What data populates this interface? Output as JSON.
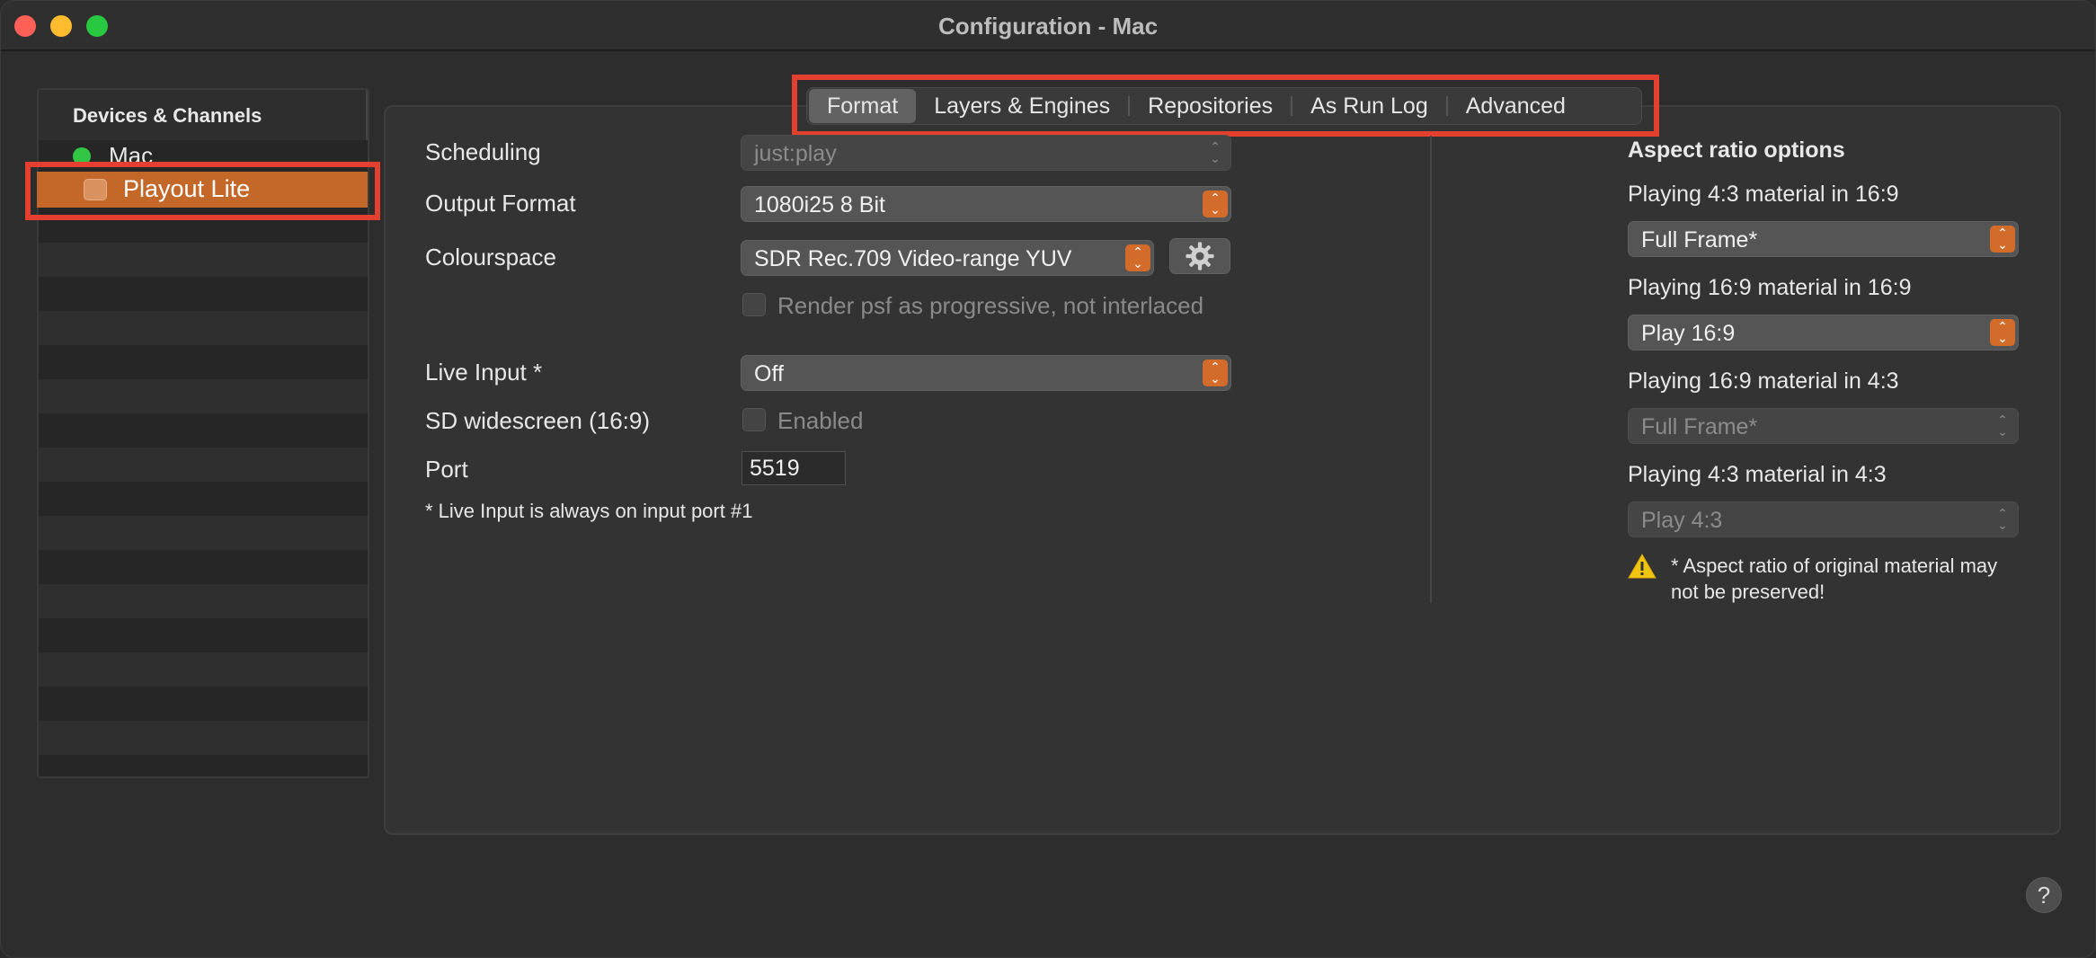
{
  "window": {
    "title": "Configuration - Mac"
  },
  "sidebar": {
    "header": "Devices & Channels",
    "device": {
      "label": "Mac",
      "status_color": "#31c744"
    },
    "selected_item": {
      "label": "Playout Lite",
      "highlight_color": "#c4682a"
    }
  },
  "tabs": [
    {
      "label": "Format",
      "active": true
    },
    {
      "label": "Layers & Engines",
      "active": false
    },
    {
      "label": "Repositories",
      "active": false
    },
    {
      "label": "As Run Log",
      "active": false
    },
    {
      "label": "Advanced",
      "active": false
    }
  ],
  "format": {
    "scheduling": {
      "label": "Scheduling",
      "value": "just:play",
      "enabled": false
    },
    "output_format": {
      "label": "Output Format",
      "value": "1080i25 8 Bit"
    },
    "colourspace": {
      "label": "Colourspace",
      "value": "SDR Rec.709 Video-range YUV"
    },
    "render_psf": {
      "label": "Render psf as progressive, not interlaced",
      "checked": false,
      "enabled": false
    },
    "live_input": {
      "label": "Live Input *",
      "value": "Off"
    },
    "sd_widescreen": {
      "label": "SD widescreen (16:9)",
      "checkbox_label": "Enabled",
      "checked": false,
      "enabled": false
    },
    "port": {
      "label": "Port",
      "value": "5519"
    },
    "note": "* Live Input is always on input port #1"
  },
  "aspect": {
    "title": "Aspect ratio options",
    "options": [
      {
        "label": "Playing 4:3 material in 16:9",
        "value": "Full Frame*",
        "enabled": true
      },
      {
        "label": "Playing 16:9 material in 16:9",
        "value": "Play 16:9",
        "enabled": true
      },
      {
        "label": "Playing 16:9 material in 4:3",
        "value": "Full Frame*",
        "enabled": false
      },
      {
        "label": "Playing 4:3 material in 4:3",
        "value": "Play 4:3",
        "enabled": false
      }
    ],
    "warning": "* Aspect ratio of original material may not be preserved!"
  },
  "help": {
    "label": "?"
  },
  "colors": {
    "accent": "#d36c2a",
    "highlight_outline": "#e3402f"
  }
}
